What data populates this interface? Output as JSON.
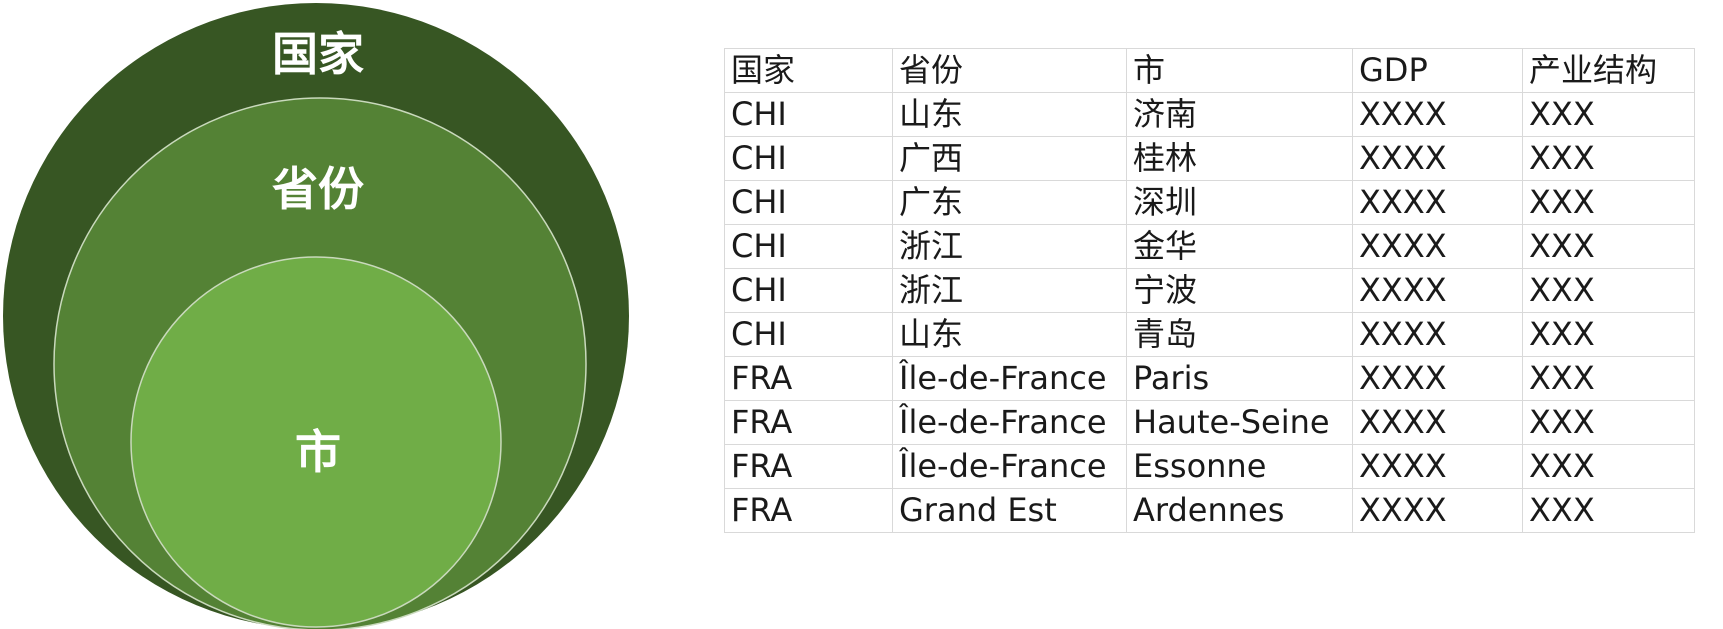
{
  "diagram": {
    "levels": [
      {
        "label": "国家",
        "color": "#375623"
      },
      {
        "label": "省份",
        "color": "#548235"
      },
      {
        "label": "市",
        "color": "#70ad47"
      }
    ],
    "outline_color": "#c9d9bc"
  },
  "table": {
    "headers": [
      "国家",
      "省份",
      "市",
      "GDP",
      "产业结构"
    ],
    "rows": [
      [
        "CHI",
        "山东",
        "济南",
        "XXXX",
        "XXX"
      ],
      [
        "CHI",
        "广西",
        "桂林",
        "XXXX",
        "XXX"
      ],
      [
        "CHI",
        "广东",
        "深圳",
        "XXXX",
        "XXX"
      ],
      [
        "CHI",
        "浙江",
        "金华",
        "XXXX",
        "XXX"
      ],
      [
        "CHI",
        "浙江",
        "宁波",
        "XXXX",
        "XXX"
      ],
      [
        "CHI",
        "山东",
        "青岛",
        "XXXX",
        "XXX"
      ],
      [
        "FRA",
        "Île-de-France",
        "Paris",
        "XXXX",
        "XXX"
      ],
      [
        "FRA",
        "Île-de-France",
        "Haute-Seine",
        "XXXX",
        "XXX"
      ],
      [
        "FRA",
        "Île-de-France",
        "Essonne",
        "XXXX",
        "XXX"
      ],
      [
        "FRA",
        "Grand Est",
        "Ardennes",
        "XXXX",
        "XXX"
      ]
    ],
    "border_color": "#d9d9d9"
  }
}
